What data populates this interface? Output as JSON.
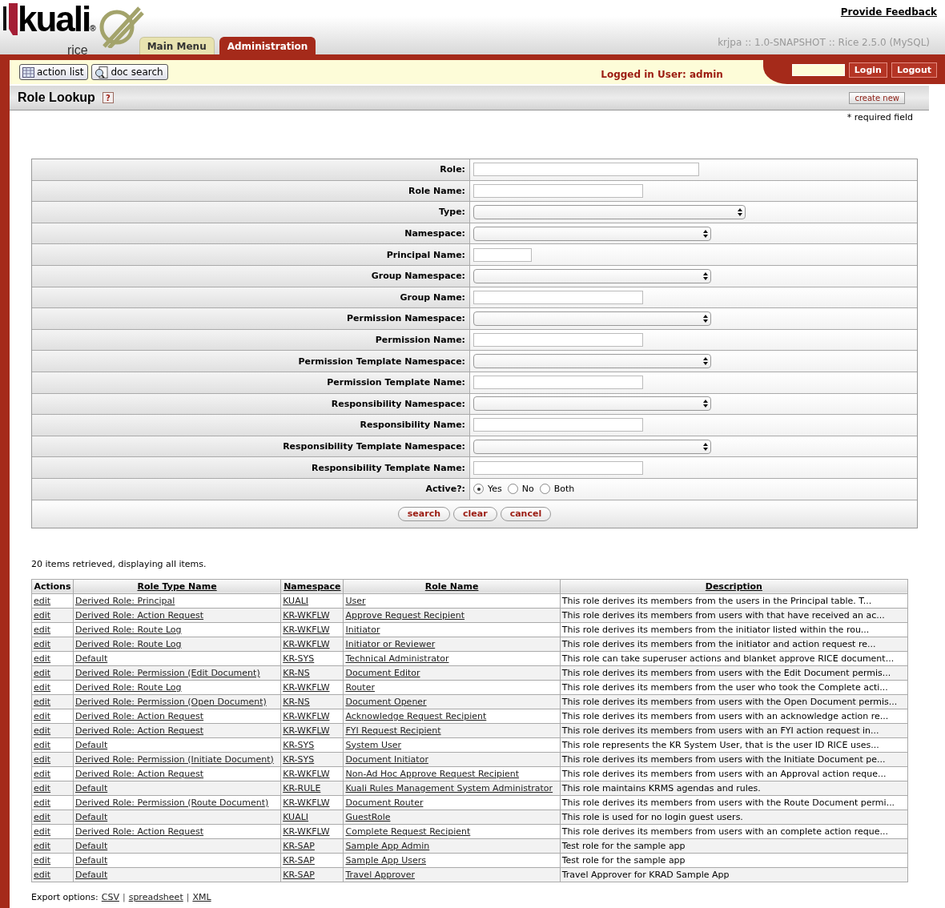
{
  "header": {
    "logo": {
      "word": "kuali",
      "mark": "®",
      "sub": "rice"
    },
    "tabs": [
      {
        "label": "Main Menu",
        "selected": false
      },
      {
        "label": "Administration",
        "selected": true
      }
    ],
    "feedback_link": "Provide Feedback",
    "version": "krjpa :: 1.0-SNAPSHOT :: Rice 2.5.0 (MySQL)"
  },
  "toolbar": {
    "buttons": [
      {
        "label": "action list",
        "kind": "list"
      },
      {
        "label": "doc search",
        "kind": "search"
      }
    ],
    "logged_in": "Logged in User: admin",
    "login": "Login",
    "logout": "Logout"
  },
  "page": {
    "title": "Role Lookup",
    "help": "?",
    "create_new": "create new",
    "required_note": "* required field"
  },
  "form": {
    "fields": [
      {
        "label": "Role:",
        "kind": "text"
      },
      {
        "label": "Role Name:",
        "kind": "text"
      },
      {
        "label": "Type:",
        "kind": "select"
      },
      {
        "label": "Namespace:",
        "kind": "select"
      },
      {
        "label": "Principal Name:",
        "kind": "text"
      },
      {
        "label": "Group Namespace:",
        "kind": "select"
      },
      {
        "label": "Group Name:",
        "kind": "text"
      },
      {
        "label": "Permission Namespace:",
        "kind": "select"
      },
      {
        "label": "Permission Name:",
        "kind": "text"
      },
      {
        "label": "Permission Template Namespace:",
        "kind": "select"
      },
      {
        "label": "Permission Template Name:",
        "kind": "text"
      },
      {
        "label": "Responsibility Namespace:",
        "kind": "select"
      },
      {
        "label": "Responsibility Name:",
        "kind": "text"
      },
      {
        "label": "Responsibility Template Namespace:",
        "kind": "select"
      },
      {
        "label": "Responsibility Template Name:",
        "kind": "text"
      },
      {
        "label": "Active?:",
        "kind": "radio",
        "options": [
          {
            "label": "Yes",
            "selected": true
          },
          {
            "label": "No",
            "selected": false
          },
          {
            "label": "Both",
            "selected": false
          }
        ]
      }
    ],
    "buttons": [
      "search",
      "clear",
      "cancel"
    ]
  },
  "results": {
    "summary": "20 items retrieved, displaying all items.",
    "columns": [
      "Actions",
      "Role Type Name",
      "Namespace",
      "Role Name",
      "Description"
    ],
    "rows": [
      [
        "edit",
        "Derived Role: Principal",
        "KUALI",
        "User",
        "This role derives its members from the users in the Principal table. T..."
      ],
      [
        "edit",
        "Derived Role: Action Request",
        "KR-WKFLW",
        "Approve Request Recipient",
        "This role derives its members from users with that have received an ac..."
      ],
      [
        "edit",
        "Derived Role: Route Log",
        "KR-WKFLW",
        "Initiator",
        "This role derives its members from the initiator listed within the rou..."
      ],
      [
        "edit",
        "Derived Role: Route Log",
        "KR-WKFLW",
        "Initiator or Reviewer",
        "This role derives its members from the initiator and action request re..."
      ],
      [
        "edit",
        "Default",
        "KR-SYS",
        "Technical Administrator",
        "This role can take superuser actions and blanket approve RICE document..."
      ],
      [
        "edit",
        "Derived Role: Permission (Edit Document)",
        "KR-NS",
        "Document Editor",
        "This role derives its members from users with the Edit Document permis..."
      ],
      [
        "edit",
        "Derived Role: Route Log",
        "KR-WKFLW",
        "Router",
        "This role derives its members from the user who took the Complete acti..."
      ],
      [
        "edit",
        "Derived Role: Permission (Open Document)",
        "KR-NS",
        "Document Opener",
        "This role derives its members from users with the Open Document permis..."
      ],
      [
        "edit",
        "Derived Role: Action Request",
        "KR-WKFLW",
        "Acknowledge Request Recipient",
        "This role derives its members from users with an acknowledge action re..."
      ],
      [
        "edit",
        "Derived Role: Action Request",
        "KR-WKFLW",
        "FYI Request Recipient",
        "This role derives its members from users with an FYI action request in..."
      ],
      [
        "edit",
        "Default",
        "KR-SYS",
        "System User",
        "This role represents the KR System User, that is the user ID RICE uses..."
      ],
      [
        "edit",
        "Derived Role: Permission (Initiate Document)",
        "KR-SYS",
        "Document Initiator",
        "This role derives its members from users with the Initiate Document pe..."
      ],
      [
        "edit",
        "Derived Role: Action Request",
        "KR-WKFLW",
        "Non-Ad Hoc Approve Request Recipient",
        "This role derives its members from users with an Approval action reque..."
      ],
      [
        "edit",
        "Default",
        "KR-RULE",
        "Kuali Rules Management System Administrator",
        "This role maintains KRMS agendas and rules."
      ],
      [
        "edit",
        "Derived Role: Permission (Route Document)",
        "KR-WKFLW",
        "Document Router",
        "This role derives its members from users with the Route Document permi..."
      ],
      [
        "edit",
        "Default",
        "KUALI",
        "GuestRole",
        "This role is used for no login guest users."
      ],
      [
        "edit",
        "Derived Role: Action Request",
        "KR-WKFLW",
        "Complete Request Recipient",
        "This role derives its members from users with an complete action reque..."
      ],
      [
        "edit",
        "Default",
        "KR-SAP",
        "Sample App Admin",
        "Test role for the sample app"
      ],
      [
        "edit",
        "Default",
        "KR-SAP",
        "Sample App Users",
        "Test role for the sample app"
      ],
      [
        "edit",
        "Default",
        "KR-SAP",
        "Travel Approver",
        "Travel Approver for KRAD Sample App"
      ]
    ],
    "export_label": "Export options:",
    "export_links": [
      "CSV",
      "spreadsheet",
      "XML"
    ],
    "export_separator": "|"
  }
}
